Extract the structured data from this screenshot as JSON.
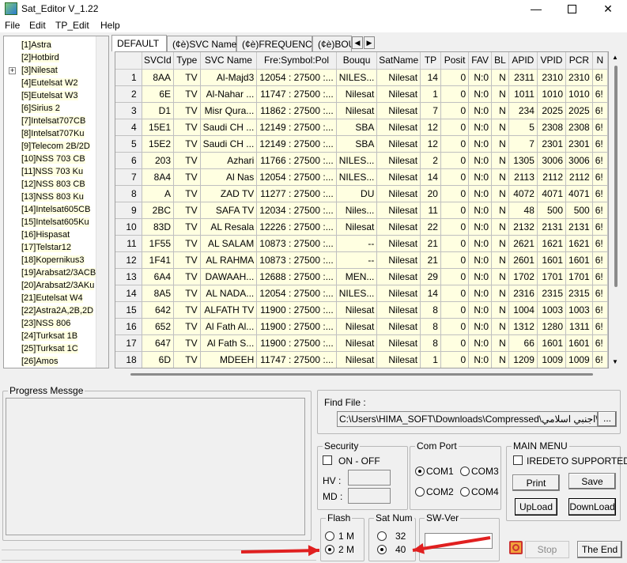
{
  "window": {
    "title": "Sat_Editor V_1.22"
  },
  "menu": [
    "File",
    "Edit",
    "TP_Edit",
    "Help"
  ],
  "tree": [
    "[1]Astra",
    "[2]Hotbird",
    "[3]Nilesat",
    "[4]Eutelsat W2",
    "[5]Eutelsat W3",
    "[6]Sirius 2",
    "[7]Intelsat707CB",
    "[8]Intelsat707Ku",
    "[9]Telecom 2B/2D",
    "[10]NSS 703 CB",
    "[11]NSS 703 Ku",
    "[12]NSS 803 CB",
    "[13]NSS 803 Ku",
    "[14]Intelsat605CB",
    "[15]Intelsat605Ku",
    "[16]Hispasat",
    "[17]Telstar12",
    "[18]Kopernikus3",
    "[19]Arabsat2/3ACB",
    "[20]Arabsat2/3AKu",
    "[21]Eutelsat W4",
    "[22]Astra2A,2B,2D",
    "[23]NSS 806",
    "[24]Turksat 1B",
    "[25]Turksat 1C",
    "[26]Amos"
  ],
  "tree_expander": "+",
  "tabs": [
    "DEFAULT",
    "(¢è)SVC Name",
    "(¢è)FREQUENCY",
    "(¢è)BOU"
  ],
  "columns": [
    "",
    "SVCId",
    "Type",
    "SVC Name",
    "Fre:Symbol:Pol",
    "Bouqu",
    "SatName",
    "TP",
    "Posit",
    "FAV",
    "BL",
    "APID",
    "VPID",
    "PCR",
    "N"
  ],
  "rows": [
    [
      "1",
      "8AA",
      "TV",
      "Al-Majd3",
      "12054 : 27500 :...",
      "NILES...",
      "Nilesat",
      "14",
      "0",
      "N:0",
      "N",
      "2311",
      "2310",
      "2310",
      "6!"
    ],
    [
      "2",
      "6E",
      "TV",
      "Al-Nahar ...",
      "11747 : 27500 :...",
      "Nilesat",
      "Nilesat",
      "1",
      "0",
      "N:0",
      "N",
      "1011",
      "1010",
      "1010",
      "6!"
    ],
    [
      "3",
      "D1",
      "TV",
      "Misr Qura...",
      "11862 : 27500 :...",
      "Nilesat",
      "Nilesat",
      "7",
      "0",
      "N:0",
      "N",
      "234",
      "2025",
      "2025",
      "6!"
    ],
    [
      "4",
      "15E1",
      "TV",
      "Saudi CH ...",
      "12149 : 27500 :...",
      "SBA",
      "Nilesat",
      "12",
      "0",
      "N:0",
      "N",
      "5",
      "2308",
      "2308",
      "6!"
    ],
    [
      "5",
      "15E2",
      "TV",
      "Saudi CH ...",
      "12149 : 27500 :...",
      "SBA",
      "Nilesat",
      "12",
      "0",
      "N:0",
      "N",
      "7",
      "2301",
      "2301",
      "6!"
    ],
    [
      "6",
      "203",
      "TV",
      "Azhari",
      "11766 : 27500 :...",
      "NILES...",
      "Nilesat",
      "2",
      "0",
      "N:0",
      "N",
      "1305",
      "3006",
      "3006",
      "6!"
    ],
    [
      "7",
      "8A4",
      "TV",
      "Al Nas",
      "12054 : 27500 :...",
      "NILES...",
      "Nilesat",
      "14",
      "0",
      "N:0",
      "N",
      "2113",
      "2112",
      "2112",
      "6!"
    ],
    [
      "8",
      "A",
      "TV",
      "ZAD TV",
      "11277 : 27500 :...",
      "DU",
      "Nilesat",
      "20",
      "0",
      "N:0",
      "N",
      "4072",
      "4071",
      "4071",
      "6!"
    ],
    [
      "9",
      "2BC",
      "TV",
      "SAFA TV",
      "12034 : 27500 :...",
      "Niles...",
      "Nilesat",
      "11",
      "0",
      "N:0",
      "N",
      "48",
      "500",
      "500",
      "6!"
    ],
    [
      "10",
      "83D",
      "TV",
      "AL Resala",
      "12226 : 27500 :...",
      "Nilesat",
      "Nilesat",
      "22",
      "0",
      "N:0",
      "N",
      "2132",
      "2131",
      "2131",
      "6!"
    ],
    [
      "11",
      "1F55",
      "TV",
      "AL SALAM",
      "10873 : 27500 :...",
      "--",
      "Nilesat",
      "21",
      "0",
      "N:0",
      "N",
      "2621",
      "1621",
      "1621",
      "6!"
    ],
    [
      "12",
      "1F41",
      "TV",
      "AL RAHMA",
      "10873 : 27500 :...",
      "--",
      "Nilesat",
      "21",
      "0",
      "N:0",
      "N",
      "2601",
      "1601",
      "1601",
      "6!"
    ],
    [
      "13",
      "6A4",
      "TV",
      "DAWAAH...",
      "12688 : 27500 :...",
      "MEN...",
      "Nilesat",
      "29",
      "0",
      "N:0",
      "N",
      "1702",
      "1701",
      "1701",
      "6!"
    ],
    [
      "14",
      "8A5",
      "TV",
      "AL NADA...",
      "12054 : 27500 :...",
      "NILES...",
      "Nilesat",
      "14",
      "0",
      "N:0",
      "N",
      "2316",
      "2315",
      "2315",
      "6!"
    ],
    [
      "15",
      "642",
      "TV",
      "ALFATH TV",
      "11900 : 27500 :...",
      "Nilesat",
      "Nilesat",
      "8",
      "0",
      "N:0",
      "N",
      "1004",
      "1003",
      "1003",
      "6!"
    ],
    [
      "16",
      "652",
      "TV",
      "Al Fath Al...",
      "11900 : 27500 :...",
      "Nilesat",
      "Nilesat",
      "8",
      "0",
      "N:0",
      "N",
      "1312",
      "1280",
      "1311",
      "6!"
    ],
    [
      "17",
      "647",
      "TV",
      "Al Fath S...",
      "11900 : 27500 :...",
      "Nilesat",
      "Nilesat",
      "8",
      "0",
      "N:0",
      "N",
      "66",
      "1601",
      "1601",
      "6!"
    ],
    [
      "18",
      "6D",
      "TV",
      "MDEEH",
      "11747 : 27500 :...",
      "Nilesat",
      "Nilesat",
      "1",
      "0",
      "N:0",
      "N",
      "1209",
      "1009",
      "1009",
      "6!"
    ]
  ],
  "progress": {
    "label": "Progress Messge"
  },
  "findfile": {
    "label": "Find File :",
    "path": "C:\\Users\\HIMA_SOFT\\Downloads\\Compressed\\اجنبي اسلامي\\SAT",
    "browse": "..."
  },
  "security": {
    "label": "Security",
    "onoff": "ON - OFF",
    "hv": "HV :",
    "md": "MD :"
  },
  "comport": {
    "label": "Com Port",
    "options": [
      "COM1",
      "COM3",
      "COM2",
      "COM4"
    ]
  },
  "mainmenu": {
    "label": "MAIN MENU",
    "irdeto": "IREDETO SUPPORTED",
    "print": "Print",
    "save": "Save",
    "upload": "UpLoad",
    "download": "DownLoad"
  },
  "flash": {
    "label": "Flash",
    "options": [
      "1 M",
      "2 M"
    ]
  },
  "satnum": {
    "label": "Sat Num",
    "options": [
      "32",
      "40"
    ]
  },
  "swver": {
    "label": "SW-Ver"
  },
  "bottom": {
    "stop": "Stop",
    "theend": "The End"
  },
  "arrow_color": "#e02020"
}
